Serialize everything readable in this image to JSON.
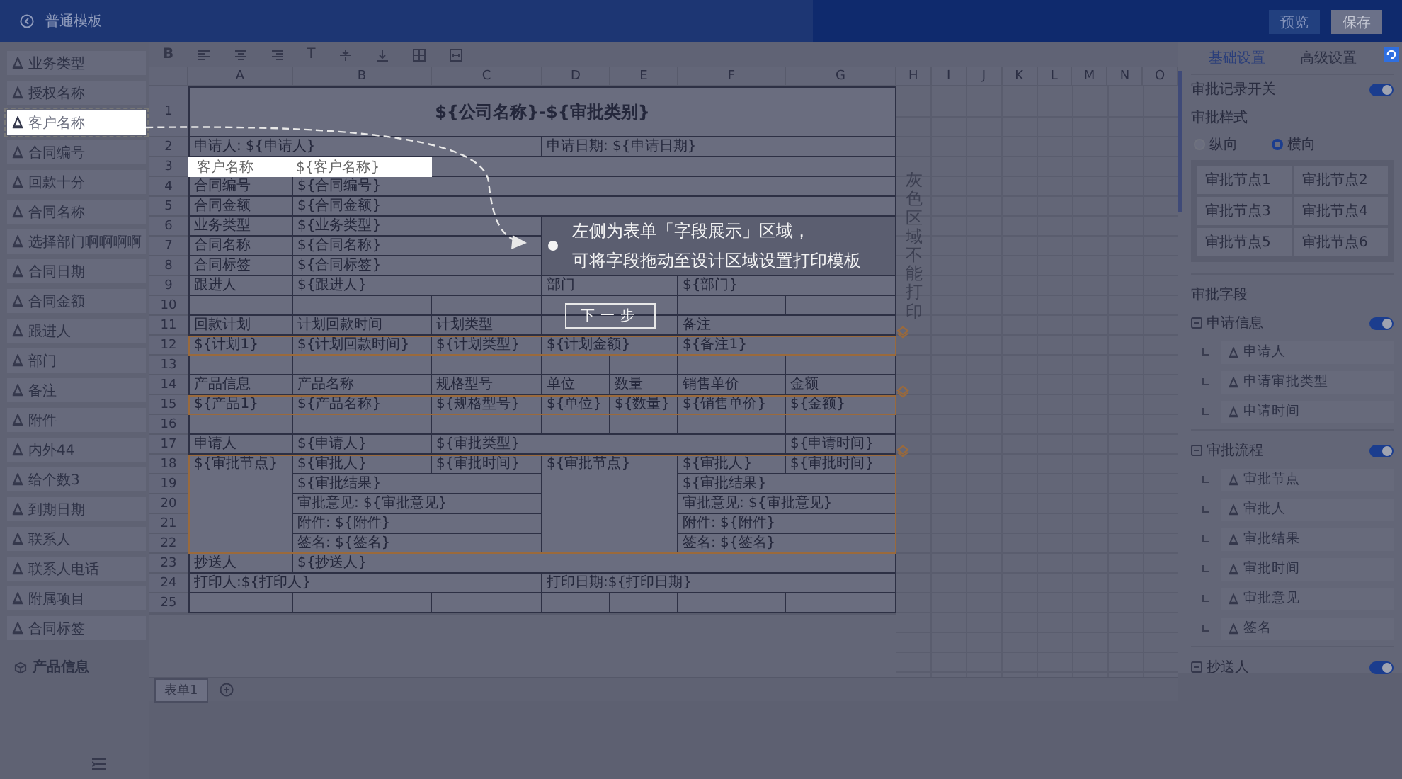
{
  "header": {
    "title": "普通模板",
    "buttons": [
      {
        "label": "预览",
        "kind": "secondary"
      },
      {
        "label": "保存",
        "kind": "primary"
      }
    ]
  },
  "sidebar": {
    "items": [
      {
        "label": "业务类型",
        "highlighted": false
      },
      {
        "label": "授权名称",
        "highlighted": false
      },
      {
        "label": "客户名称",
        "highlighted": true
      },
      {
        "label": "合同编号",
        "highlighted": false
      },
      {
        "label": "回款十分",
        "highlighted": false
      },
      {
        "label": "合同名称",
        "highlighted": false
      },
      {
        "label": "选择部门啊啊啊啊",
        "highlighted": false
      },
      {
        "label": "合同日期",
        "highlighted": false
      },
      {
        "label": "合同金额",
        "highlighted": false
      },
      {
        "label": "跟进人",
        "highlighted": false
      },
      {
        "label": "部门",
        "highlighted": false
      },
      {
        "label": "备注",
        "highlighted": false
      },
      {
        "label": "附件",
        "highlighted": false
      },
      {
        "label": "内外44",
        "highlighted": false
      },
      {
        "label": "给个数3",
        "highlighted": false
      },
      {
        "label": "到期日期",
        "highlighted": false
      },
      {
        "label": "联系人",
        "highlighted": false
      },
      {
        "label": "联系人电话",
        "highlighted": false
      },
      {
        "label": "附属项目",
        "highlighted": false
      },
      {
        "label": "合同标签",
        "highlighted": false
      }
    ],
    "section": "产品信息"
  },
  "sheet": {
    "toolbar": [
      {
        "kind": "bold",
        "label": "B"
      },
      {
        "kind": "align-left"
      },
      {
        "kind": "align-center"
      },
      {
        "kind": "align-right"
      },
      {
        "kind": "text",
        "label": "T"
      },
      {
        "kind": "valign-middle"
      },
      {
        "kind": "valign-bottom"
      },
      {
        "kind": "borders"
      },
      {
        "kind": "merge"
      }
    ],
    "columns": [
      "A",
      "B",
      "C",
      "D",
      "E",
      "F",
      "G",
      "H",
      "I",
      "J",
      "K",
      "L",
      "M",
      "N",
      "O"
    ],
    "rows": [
      {
        "number": "1",
        "cells": [
          "${公司名称}-${审批类别}"
        ]
      },
      {
        "number": "2",
        "cells": [
          "申请人: ${申请人}",
          "申请日期: ${申请日期}"
        ]
      },
      {
        "number": "3"
      },
      {
        "number": "4",
        "cells": [
          "合同编号",
          "${合同编号}"
        ]
      },
      {
        "number": "5",
        "cells": [
          "合同金额",
          "${合同金额}"
        ]
      },
      {
        "number": "6",
        "cells": [
          "业务类型",
          "${业务类型}"
        ]
      },
      {
        "number": "7",
        "cells": [
          "合同名称",
          "${合同名称}"
        ]
      },
      {
        "number": "8",
        "cells": [
          "合同标签",
          "${合同标签}"
        ]
      },
      {
        "number": "9",
        "cells": [
          "跟进人",
          "${跟进人}",
          "部门",
          "${部门}"
        ]
      },
      {
        "number": "10"
      },
      {
        "number": "11",
        "cells": [
          "回款计划",
          "计划回款时间",
          "计划类型",
          "备注"
        ]
      },
      {
        "number": "12",
        "cells": [
          "${计划1}",
          "${计划回款时间}",
          "${计划类型}",
          "${计划金额}",
          "${备注1}"
        ]
      },
      {
        "number": "13"
      },
      {
        "number": "14",
        "cells": [
          "产品信息",
          "产品名称",
          "规格型号",
          "单位",
          "数量",
          "销售单价",
          "金额"
        ]
      },
      {
        "number": "15",
        "cells": [
          "${产品1}",
          "${产品名称}",
          "${规格型号}",
          "${单位}",
          "${数量}",
          "${销售单价}",
          "${金额}"
        ]
      },
      {
        "number": "16"
      },
      {
        "number": "17",
        "cells": [
          "申请人",
          "${申请人}",
          "${审批类型}",
          "${申请时间}"
        ]
      },
      {
        "number": "18",
        "cells": [
          "${审批节点}",
          "${审批人}",
          "${审批时间}",
          "${审批节点}",
          "${审批人}",
          "${审批时间}"
        ]
      },
      {
        "number": "19",
        "cells": [
          "${审批结果}",
          "${审批结果}"
        ]
      },
      {
        "number": "20",
        "cells": [
          "审批意见: ${审批意见}",
          "审批意见: ${审批意见}"
        ]
      },
      {
        "number": "21",
        "cells": [
          "附件: ${附件}",
          "附件: ${附件}"
        ]
      },
      {
        "number": "22",
        "cells": [
          "签名: ${签名}",
          "签名: ${签名}"
        ]
      },
      {
        "number": "23",
        "cells": [
          "抄送人",
          "${抄送人}"
        ]
      },
      {
        "number": "24",
        "cells": [
          "打印人:${打印人}",
          "打印日期:${打印日期}"
        ]
      },
      {
        "number": "25"
      }
    ],
    "note": "灰色区域不能打印",
    "tabs": [
      {
        "label": "表单1",
        "selected": true
      }
    ]
  },
  "guide": {
    "ghost": {
      "label": "客户名称",
      "value": "${客户名称}"
    },
    "lines": [
      "左侧为表单「字段展示」区域，",
      "可将字段拖动至设计区域设置打印模板"
    ],
    "next_button": "下一步"
  },
  "settings": {
    "tabs": [
      {
        "label": "基础设置",
        "selected": true
      },
      {
        "label": "高级设置",
        "selected": false
      }
    ],
    "record_switch": {
      "label": "审批记录开关",
      "on": true
    },
    "style": {
      "label": "审批样式",
      "options": [
        {
          "label": "纵向",
          "selected": false
        },
        {
          "label": "横向",
          "selected": true
        }
      ],
      "nodes": [
        "审批节点1",
        "审批节点2",
        "审批节点3",
        "审批节点4",
        "审批节点5",
        "审批节点6"
      ]
    },
    "fields_title": "审批字段",
    "groups": [
      {
        "label": "申请信息",
        "on": true,
        "items": [
          "申请人",
          "申请审批类型",
          "申请时间"
        ]
      },
      {
        "label": "审批流程",
        "on": true,
        "items": [
          "审批节点",
          "审批人",
          "审批结果",
          "审批时间",
          "审批意见",
          "签名"
        ]
      },
      {
        "label": "抄送人",
        "on": true
      }
    ]
  }
}
